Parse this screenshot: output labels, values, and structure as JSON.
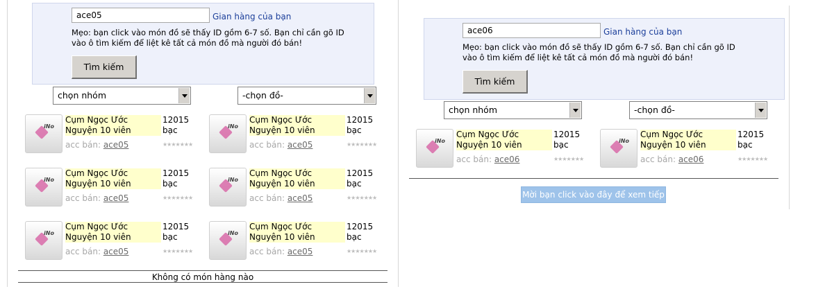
{
  "left": {
    "search_value": "ace05",
    "shop_link": "Gian hàng của bạn",
    "tip_line1": "Mẹo: bạn click vào món đồ sẽ thấy ID gồm 6-7 số. Bạn chỉ cần gõ ID",
    "tip_line2": "vào ô tìm kiếm để liệt kê tất cả món đồ mà người đó bán!",
    "search_button": "Tìm kiếm",
    "group_select": "chọn nhóm",
    "item_select": "-chọn đồ-",
    "items": [
      {
        "name": "Cụm Ngọc Ước Nguyện 10 viên",
        "price": "12015 bạc",
        "seller_label": "acc bán:",
        "seller": "ace05"
      },
      {
        "name": "Cụm Ngọc Ước Nguyện 10 viên",
        "price": "12015 bạc",
        "seller_label": "acc bán:",
        "seller": "ace05"
      },
      {
        "name": "Cụm Ngọc Ước Nguyện 10 viên",
        "price": "12015 bạc",
        "seller_label": "acc bán:",
        "seller": "ace05"
      },
      {
        "name": "Cụm Ngọc Ước Nguyện 10 viên",
        "price": "12015 bạc",
        "seller_label": "acc bán:",
        "seller": "ace05"
      },
      {
        "name": "Cụm Ngọc Ước Nguyện 10 viên",
        "price": "12015 bạc",
        "seller_label": "acc bán:",
        "seller": "ace05"
      },
      {
        "name": "Cụm Ngọc Ước Nguyện 10 viên",
        "price": "12015 bạc",
        "seller_label": "acc bán:",
        "seller": "ace05"
      }
    ],
    "footer_text": "Không có món hàng nào"
  },
  "right": {
    "search_value": "ace06",
    "shop_link": "Gian hàng của bạn",
    "tip_line1": "Mẹo: bạn click vào món đồ sẽ thấy ID gồm 6-7 số. Bạn chỉ cần gõ ID",
    "tip_line2": "vào ô tìm kiếm để liệt kê tất cả món đồ mà người đó bán!",
    "search_button": "Tìm kiếm",
    "group_select": "chọn nhóm",
    "item_select": "-chọn đồ-",
    "items": [
      {
        "name": "Cụm Ngọc Ước Nguyện 10 viên",
        "price": "12015 bạc",
        "seller_label": "acc bán:",
        "seller": "ace06"
      },
      {
        "name": "Cụm Ngọc Ước Nguyện 10 viên",
        "price": "12015 bạc",
        "seller_label": "acc bán:",
        "seller": "ace06"
      }
    ],
    "more_button": "Mời bạn click vào đây để xem tiếp"
  },
  "icons": {
    "item_thumb": "wish-gem-icon",
    "rating": "rating-stars-icon"
  },
  "colors": {
    "link": "#1c3f9a",
    "search_bg": "#eef1fb",
    "name_highlight": "#ffffcc",
    "more_button": "#9ec3ea"
  }
}
